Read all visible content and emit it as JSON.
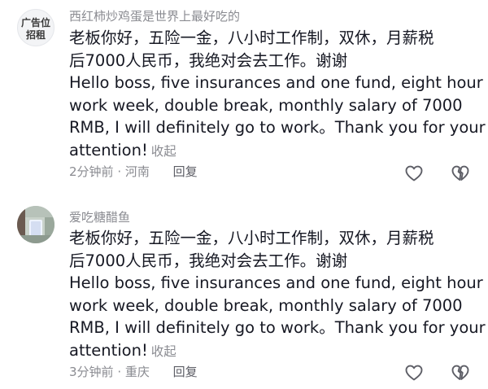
{
  "comments": [
    {
      "avatar_text_line1": "广告位",
      "avatar_text_line2": "招租",
      "username": "西红柿炒鸡蛋是世界上最好吃的",
      "body_lines": [
        "老板你好，五险一金，八小时工作制，双休，月薪税",
        "后7000人民币，我绝对会去工作。谢谢",
        "Hello boss, five insurances and one fund, eight hour",
        "work week, double break, monthly salary of 7000",
        "RMB, I will definitely go to work。Thank you for your",
        "attention!"
      ],
      "collapse_label": "收起",
      "time": "2分钟前",
      "location": "河南",
      "reply_label": "回复"
    },
    {
      "username": "爱吃糖醋鱼",
      "body_lines": [
        "老板你好，五险一金，八小时工作制，双休，月薪税",
        "后7000人民币，我绝对会去工作。谢谢",
        "Hello boss, five insurances and one fund, eight hour",
        "work week, double break, monthly salary of 7000",
        "RMB, I will definitely go to work。Thank you for your",
        "attention!"
      ],
      "collapse_label": "收起",
      "time": "3分钟前",
      "location": "重庆",
      "reply_label": "回复"
    }
  ],
  "meta_separator": " · ",
  "icons": {
    "like": "heart-outline-icon",
    "dislike": "broken-heart-outline-icon"
  },
  "colors": {
    "text": "#161823",
    "secondary": "#8a8b91",
    "reply": "#5d5e66"
  }
}
